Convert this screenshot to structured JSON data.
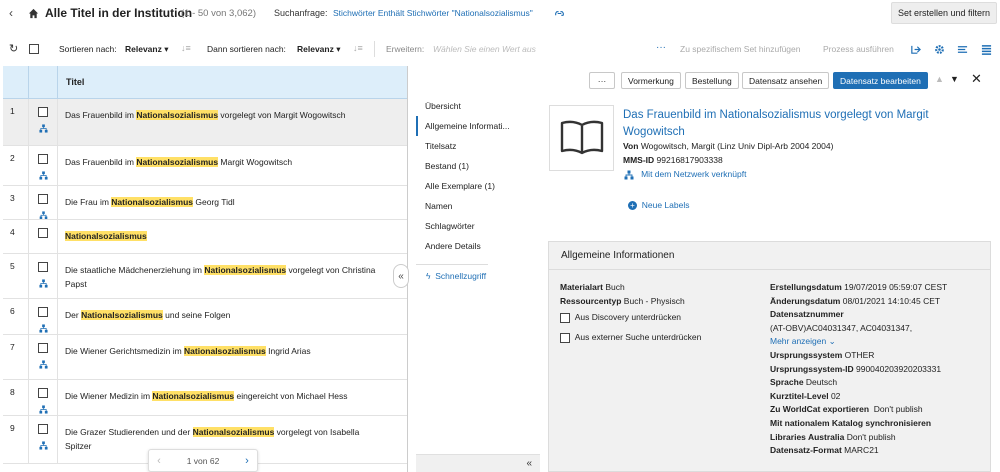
{
  "header": {
    "title": "Alle Titel in der Institution",
    "count": "(1 - 50 von 3,062)",
    "search_label": "Suchanfrage:",
    "search_query": "Stichwörter Enthält Stichwörter \"Nationalsozialismus\"",
    "set_button": "Set erstellen und filtern"
  },
  "toolbar": {
    "sort_label": "Sortieren nach:",
    "sort_value": "Relevanz",
    "then_sort_label": "Dann sortieren nach:",
    "then_sort_value": "Relevanz",
    "expand_label": "Erweitern:",
    "expand_placeholder": "Wählen Sie einen Wert aus",
    "add_to_set": "Zu spezifischem Set hinzufügen",
    "run_process": "Prozess ausführen"
  },
  "list": {
    "column_title": "Titel",
    "rows": [
      {
        "num": "1",
        "pre": "Das Frauenbild im ",
        "hl": "Nationalsozialismus",
        "post": " vorgelegt von Margit Wogowitsch",
        "post2": ""
      },
      {
        "num": "2",
        "pre": "Das Frauenbild im ",
        "hl": "Nationalsozialismus",
        "post": " Margit Wogowitsch",
        "post2": ""
      },
      {
        "num": "3",
        "pre": "Die Frau im ",
        "hl": "Nationalsozialismus",
        "post": " Georg Tidl",
        "post2": ""
      },
      {
        "num": "4",
        "pre": "",
        "hl": "Nationalsozialismus",
        "post": "",
        "post2": ""
      },
      {
        "num": "5",
        "pre": "Die staatliche Mädchenerziehung im ",
        "hl": "Nationalsozialismus",
        "post": " vorgelegt von Christina",
        "post2": "Papst"
      },
      {
        "num": "6",
        "pre": "Der ",
        "hl": "Nationalsozialismus",
        "post": " und seine Folgen",
        "post2": ""
      },
      {
        "num": "7",
        "pre": "Die Wiener Gerichtsmedizin im ",
        "hl": "Nationalsozialismus",
        "post": " Ingrid Arias",
        "post2": ""
      },
      {
        "num": "8",
        "pre": "Die Wiener Medizin im ",
        "hl": "Nationalsozialismus",
        "post": " eingereicht von Michael Hess",
        "post2": ""
      },
      {
        "num": "9",
        "pre": "Die Grazer Studierenden und der ",
        "hl": "Nationalsozialismus",
        "post": " vorgelegt von Isabella",
        "post2": "Spitzer"
      }
    ],
    "pagination": "1 von 62"
  },
  "actions": {
    "more": "···",
    "reserve": "Vormerkung",
    "order": "Bestellung",
    "view_record": "Datensatz ansehen",
    "edit_record": "Datensatz bearbeiten"
  },
  "nav": {
    "items": [
      "Übersicht",
      "Allgemeine Informati...",
      "Titelsatz",
      "Bestand (1)",
      "Alle Exemplare (1)",
      "Namen",
      "Schlagwörter",
      "Andere Details"
    ],
    "quick_access": "Schnellzugriff"
  },
  "record": {
    "title": "Das Frauenbild im Nationalsozialismus vorgelegt von Margit Wogowitsch",
    "by_label": "Von",
    "by_value": "Wogowitsch, Margit (Linz Univ Dipl-Arb 2004 2004)",
    "mms_label": "MMS-ID",
    "mms_value": "99216817903338",
    "network_link": "Mit dem Netzwerk verknüpft",
    "new_labels": "Neue Labels"
  },
  "info": {
    "heading": "Allgemeine Informationen",
    "material_label": "Materialart",
    "material_value": "Buch",
    "resource_label": "Ressourcentyp",
    "resource_value": "Buch - Physisch",
    "suppress_discovery": "Aus Discovery unterdrücken",
    "suppress_external": "Aus externer Suche unterdrücken",
    "created_label": "Erstellungsdatum",
    "created_value": "19/07/2019 05:59:07 CEST",
    "modified_label": "Änderungsdatum",
    "modified_value": "08/01/2021 14:10:45 CET",
    "record_num_label": "Datensatznummer",
    "record_num_value": "(AT-OBV)AC04031347, AC04031347,",
    "show_more": "Mehr anzeigen",
    "origin_label": "Ursprungssystem",
    "origin_value": "OTHER",
    "origin_id_label": "Ursprungssystem-ID",
    "origin_id_value": "990040203920203331",
    "lang_label": "Sprache",
    "lang_value": "Deutsch",
    "brief_label": "Kurztitel-Level",
    "brief_value": "02",
    "worldcat_label": "Zu WorldCat exportieren",
    "worldcat_value": "Don't publish",
    "natcat_label": "Mit nationalem Katalog synchronisieren",
    "libaus_label": "Libraries Australia",
    "libaus_value": "Don't publish",
    "format_label": "Datensatz-Format",
    "format_value": "MARC21"
  }
}
